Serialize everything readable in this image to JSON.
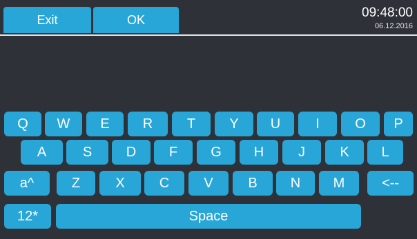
{
  "toolbar": {
    "exit_label": "Exit",
    "ok_label": "OK"
  },
  "clock": {
    "time": "09:48:00",
    "date": "06.12.2016"
  },
  "keyboard": {
    "row1": [
      "Q",
      "W",
      "E",
      "R",
      "T",
      "Y",
      "U",
      "I",
      "O",
      "P"
    ],
    "row2": [
      "A",
      "S",
      "D",
      "F",
      "G",
      "H",
      "J",
      "K",
      "L"
    ],
    "row3": [
      "a^",
      "Z",
      "X",
      "C",
      "V",
      "B",
      "N",
      "M",
      "<--"
    ],
    "row4": [
      "12*",
      "Space"
    ]
  },
  "colors": {
    "background": "#2f3138",
    "key": "#29a6d8",
    "key_text": "#ffffff",
    "divider": "#e6e6e6"
  }
}
